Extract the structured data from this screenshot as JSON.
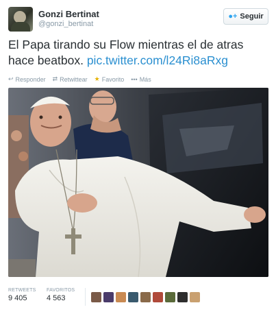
{
  "user": {
    "name": "Gonzi Bertinat",
    "handle": "@gonzi_bertinat"
  },
  "follow_button": {
    "label": "Seguir",
    "icon": "person-plus-icon"
  },
  "tweet": {
    "text_line1": "El Papa tirando su Flow mientras el de atras",
    "text_line2": "hace beatbox.",
    "link": "pic.twitter.com/l24Ri8aRxg"
  },
  "actions": [
    {
      "label": "Responder",
      "icon": "reply-icon"
    },
    {
      "label": "Retwittear",
      "icon": "retweet-icon"
    },
    {
      "label": "Favorito",
      "icon": "star-icon"
    },
    {
      "label": "Más",
      "icon": "more-dots-icon"
    }
  ],
  "stats": {
    "retweets_label": "RETWEETS",
    "retweets_count": "9 405",
    "favorites_label": "FAVORITOS",
    "favorites_count": "4 563"
  },
  "colors": {
    "link": "#2a8fd0",
    "muted": "#8899a6",
    "text": "#292f33"
  }
}
